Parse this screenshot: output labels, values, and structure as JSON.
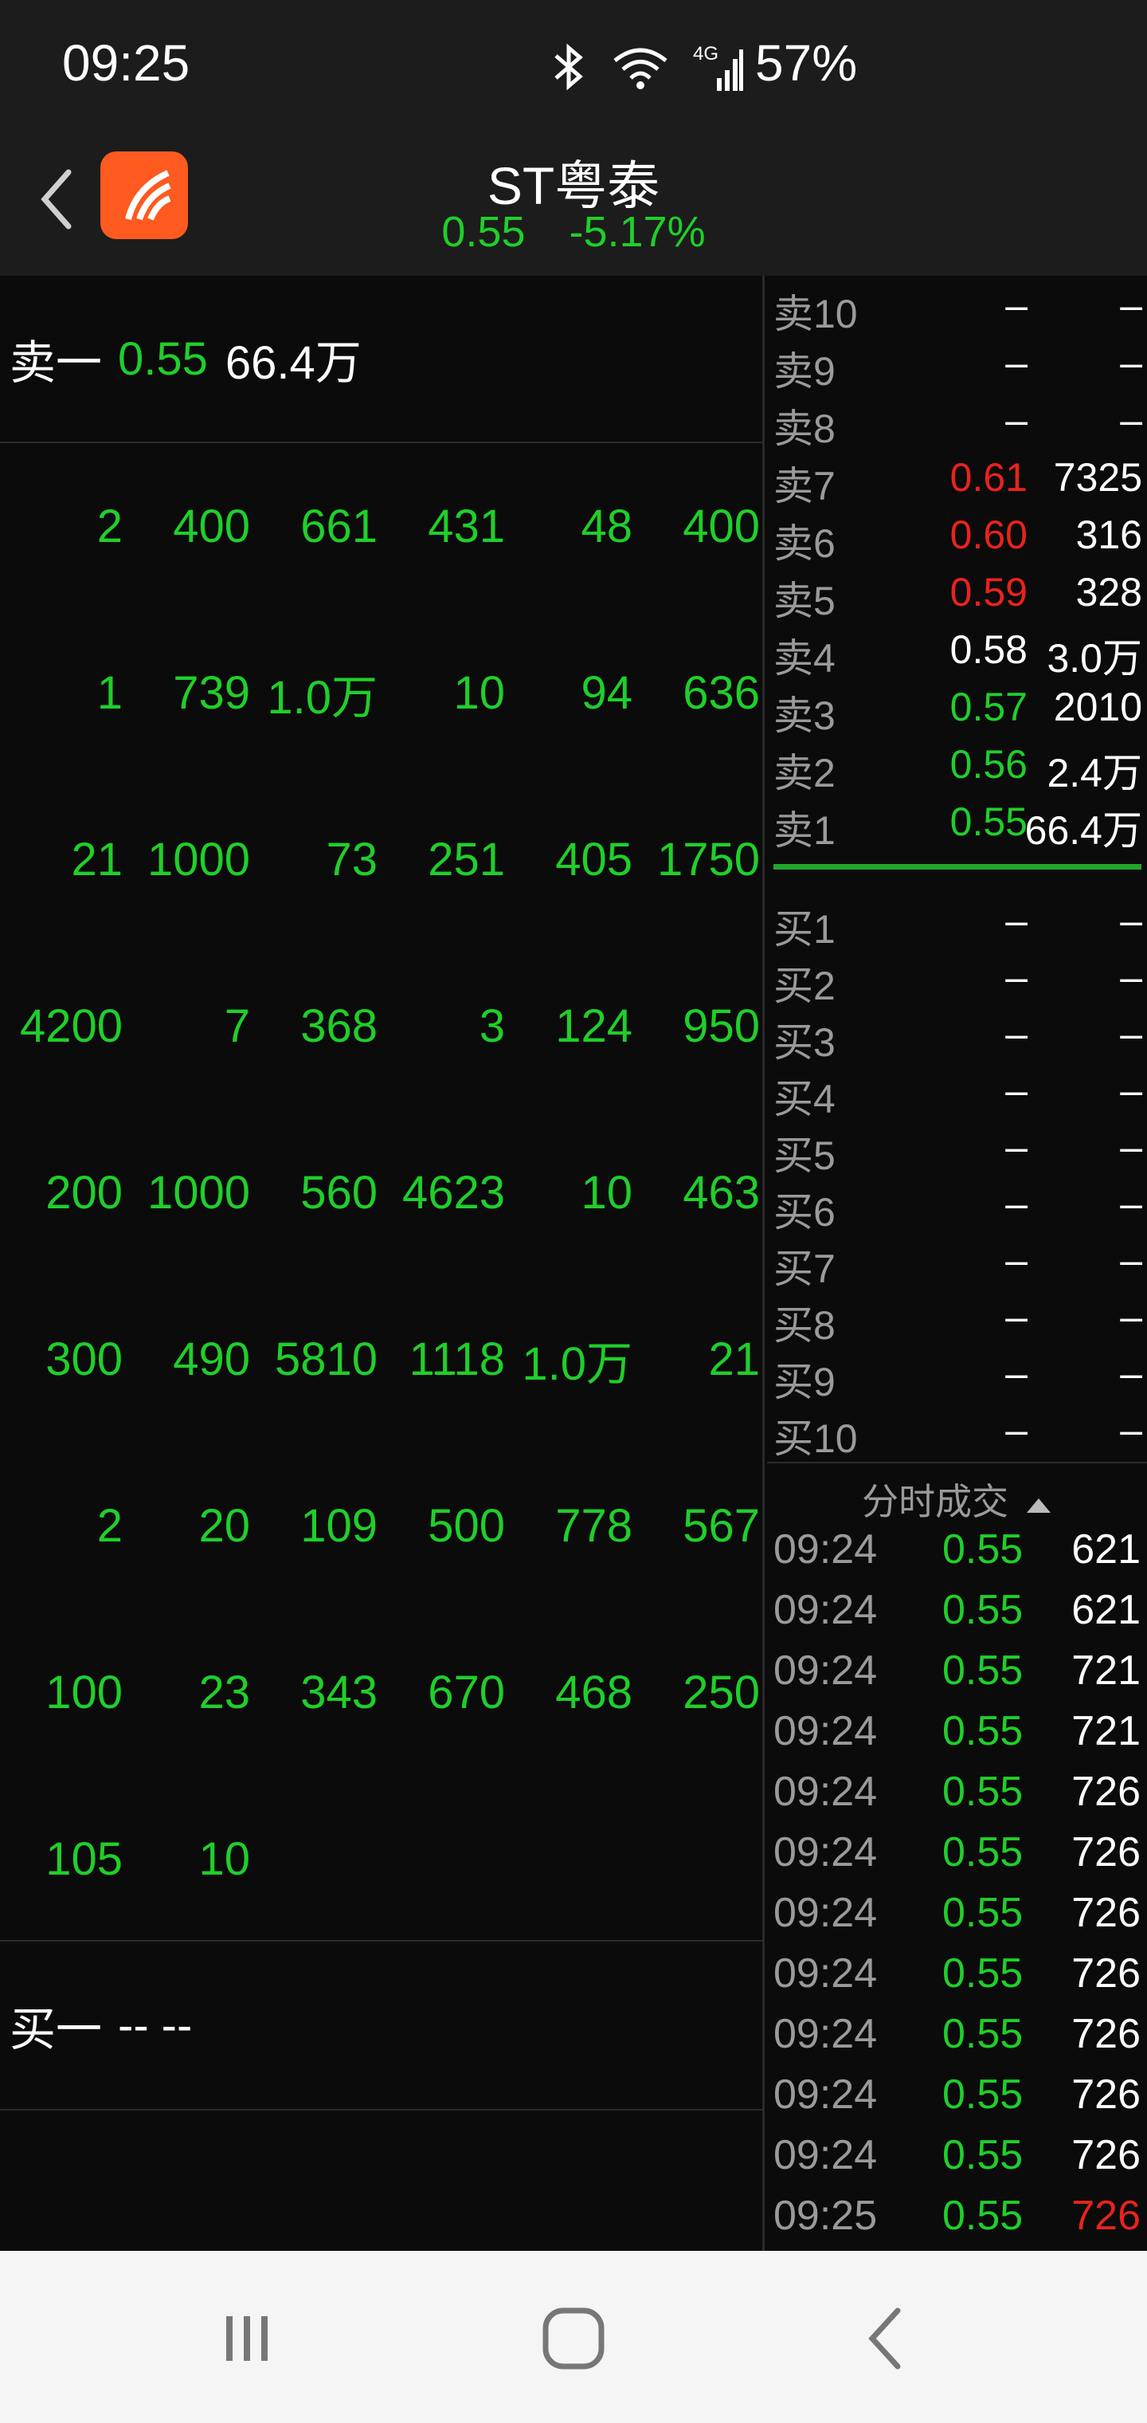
{
  "status_bar": {
    "time": "09:25",
    "battery": "57%",
    "icons": [
      "bluetooth-icon",
      "wifi-icon",
      "cellular-4g-icon"
    ],
    "network_label": "4G"
  },
  "header": {
    "title": "ST粤泰",
    "price": "0.55",
    "change_pct": "-5.17%"
  },
  "left_panel": {
    "sell1": {
      "label": "卖一",
      "price": "0.55",
      "volume": "66.4万"
    },
    "queue": [
      [
        "2",
        "400",
        "661",
        "431",
        "48",
        "400"
      ],
      [
        "1",
        "739",
        "1.0万",
        "10",
        "94",
        "636"
      ],
      [
        "21",
        "1000",
        "73",
        "251",
        "405",
        "1750"
      ],
      [
        "4200",
        "7",
        "368",
        "3",
        "124",
        "950"
      ],
      [
        "200",
        "1000",
        "560",
        "4623",
        "10",
        "463"
      ],
      [
        "300",
        "490",
        "5810",
        "1118",
        "1.0万",
        "21"
      ],
      [
        "2",
        "20",
        "109",
        "500",
        "778",
        "567"
      ],
      [
        "100",
        "23",
        "343",
        "670",
        "468",
        "250"
      ],
      [
        "105",
        "10",
        "",
        "",
        "",
        ""
      ]
    ],
    "buy1": {
      "label": "买一",
      "price": "--",
      "volume": "--"
    }
  },
  "order_book": {
    "asks": [
      {
        "label": "卖10",
        "price": "–",
        "volume": "–",
        "color": "#ffffff"
      },
      {
        "label": "卖9",
        "price": "–",
        "volume": "–",
        "color": "#ffffff"
      },
      {
        "label": "卖8",
        "price": "–",
        "volume": "–",
        "color": "#ffffff"
      },
      {
        "label": "卖7",
        "price": "0.61",
        "volume": "7325",
        "color": "#e8231c"
      },
      {
        "label": "卖6",
        "price": "0.60",
        "volume": "316",
        "color": "#e8231c"
      },
      {
        "label": "卖5",
        "price": "0.59",
        "volume": "328",
        "color": "#e8231c"
      },
      {
        "label": "卖4",
        "price": "0.58",
        "volume": "3.0万",
        "color": "#ffffff"
      },
      {
        "label": "卖3",
        "price": "0.57",
        "volume": "2010",
        "color": "#1fcf2a"
      },
      {
        "label": "卖2",
        "price": "0.56",
        "volume": "2.4万",
        "color": "#1fcf2a"
      },
      {
        "label": "卖1",
        "price": "0.55",
        "volume": "66.4万",
        "color": "#1fcf2a"
      }
    ],
    "bids": [
      {
        "label": "买1",
        "price": "–",
        "volume": "–"
      },
      {
        "label": "买2",
        "price": "–",
        "volume": "–"
      },
      {
        "label": "买3",
        "price": "–",
        "volume": "–"
      },
      {
        "label": "买4",
        "price": "–",
        "volume": "–"
      },
      {
        "label": "买5",
        "price": "–",
        "volume": "–"
      },
      {
        "label": "买6",
        "price": "–",
        "volume": "–"
      },
      {
        "label": "买7",
        "price": "–",
        "volume": "–"
      },
      {
        "label": "买8",
        "price": "–",
        "volume": "–"
      },
      {
        "label": "买9",
        "price": "–",
        "volume": "–"
      },
      {
        "label": "买10",
        "price": "–",
        "volume": "–"
      }
    ]
  },
  "ticks": {
    "header": "分时成交",
    "rows": [
      {
        "time": "09:24",
        "price": "0.55",
        "volume": "621",
        "vol_color": "#ffffff"
      },
      {
        "time": "09:24",
        "price": "0.55",
        "volume": "621",
        "vol_color": "#ffffff"
      },
      {
        "time": "09:24",
        "price": "0.55",
        "volume": "721",
        "vol_color": "#ffffff"
      },
      {
        "time": "09:24",
        "price": "0.55",
        "volume": "721",
        "vol_color": "#ffffff"
      },
      {
        "time": "09:24",
        "price": "0.55",
        "volume": "726",
        "vol_color": "#ffffff"
      },
      {
        "time": "09:24",
        "price": "0.55",
        "volume": "726",
        "vol_color": "#ffffff"
      },
      {
        "time": "09:24",
        "price": "0.55",
        "volume": "726",
        "vol_color": "#ffffff"
      },
      {
        "time": "09:24",
        "price": "0.55",
        "volume": "726",
        "vol_color": "#ffffff"
      },
      {
        "time": "09:24",
        "price": "0.55",
        "volume": "726",
        "vol_color": "#ffffff"
      },
      {
        "time": "09:24",
        "price": "0.55",
        "volume": "726",
        "vol_color": "#ffffff"
      },
      {
        "time": "09:24",
        "price": "0.55",
        "volume": "726",
        "vol_color": "#ffffff"
      },
      {
        "time": "09:25",
        "price": "0.55",
        "volume": "726",
        "vol_color": "#e8231c"
      }
    ]
  },
  "nav_bar": {
    "icons": [
      "recent-apps-icon",
      "home-icon",
      "back-nav-icon"
    ]
  }
}
